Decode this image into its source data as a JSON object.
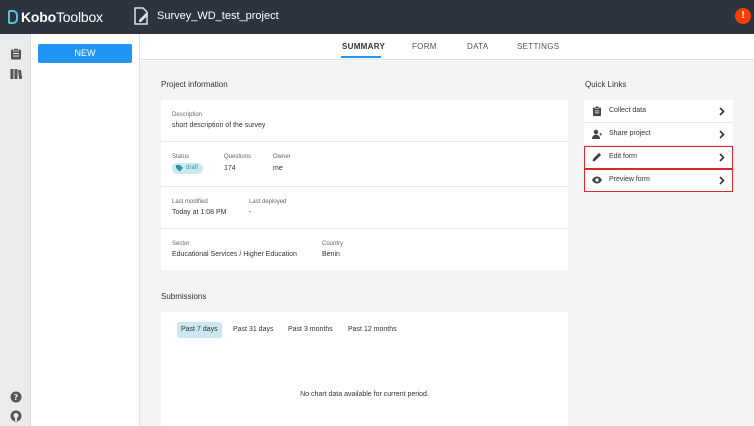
{
  "app": {
    "logo_text_a": "Kobo",
    "logo_text_b": "Toolbox",
    "project_title": "Survey_WD_test_project",
    "user_initial": "!"
  },
  "sidebar": {
    "new_label": "NEW"
  },
  "tabs": [
    {
      "label": "SUMMARY",
      "active": true
    },
    {
      "label": "FORM",
      "active": false
    },
    {
      "label": "DATA",
      "active": false
    },
    {
      "label": "SETTINGS",
      "active": false
    }
  ],
  "project_info": {
    "heading": "Project information",
    "description_label": "Description",
    "description_value": "short description of the survey",
    "status_label": "Status",
    "status_value": "draft",
    "questions_label": "Questions",
    "questions_value": "174",
    "owner_label": "Owner",
    "owner_value": "me",
    "last_modified_label": "Last modified",
    "last_modified_value": "Today at 1:08 PM",
    "last_deployed_label": "Last deployed",
    "last_deployed_value": "-",
    "sector_label": "Sector",
    "sector_value": "Educational Services / Higher Education",
    "country_label": "Country",
    "country_value": "Benin"
  },
  "quick_links": {
    "heading": "Quick Links",
    "items": [
      {
        "label": "Collect data",
        "icon": "clipboard-icon"
      },
      {
        "label": "Share project",
        "icon": "add-user-icon"
      },
      {
        "label": "Edit form",
        "icon": "pencil-icon"
      },
      {
        "label": "Preview form",
        "icon": "eye-icon"
      }
    ]
  },
  "submissions": {
    "heading": "Submissions",
    "periods": [
      {
        "label": "Past 7 days",
        "active": true
      },
      {
        "label": "Past 31 days",
        "active": false
      },
      {
        "label": "Past 3 months",
        "active": false
      },
      {
        "label": "Past 12 months",
        "active": false
      }
    ],
    "empty_message": "No chart data available for current period."
  },
  "colors": {
    "topbar": "#2d3440",
    "accent": "#2095f3",
    "highlight_border": "#e0262a",
    "badge_bg": "#cbe8f0"
  }
}
